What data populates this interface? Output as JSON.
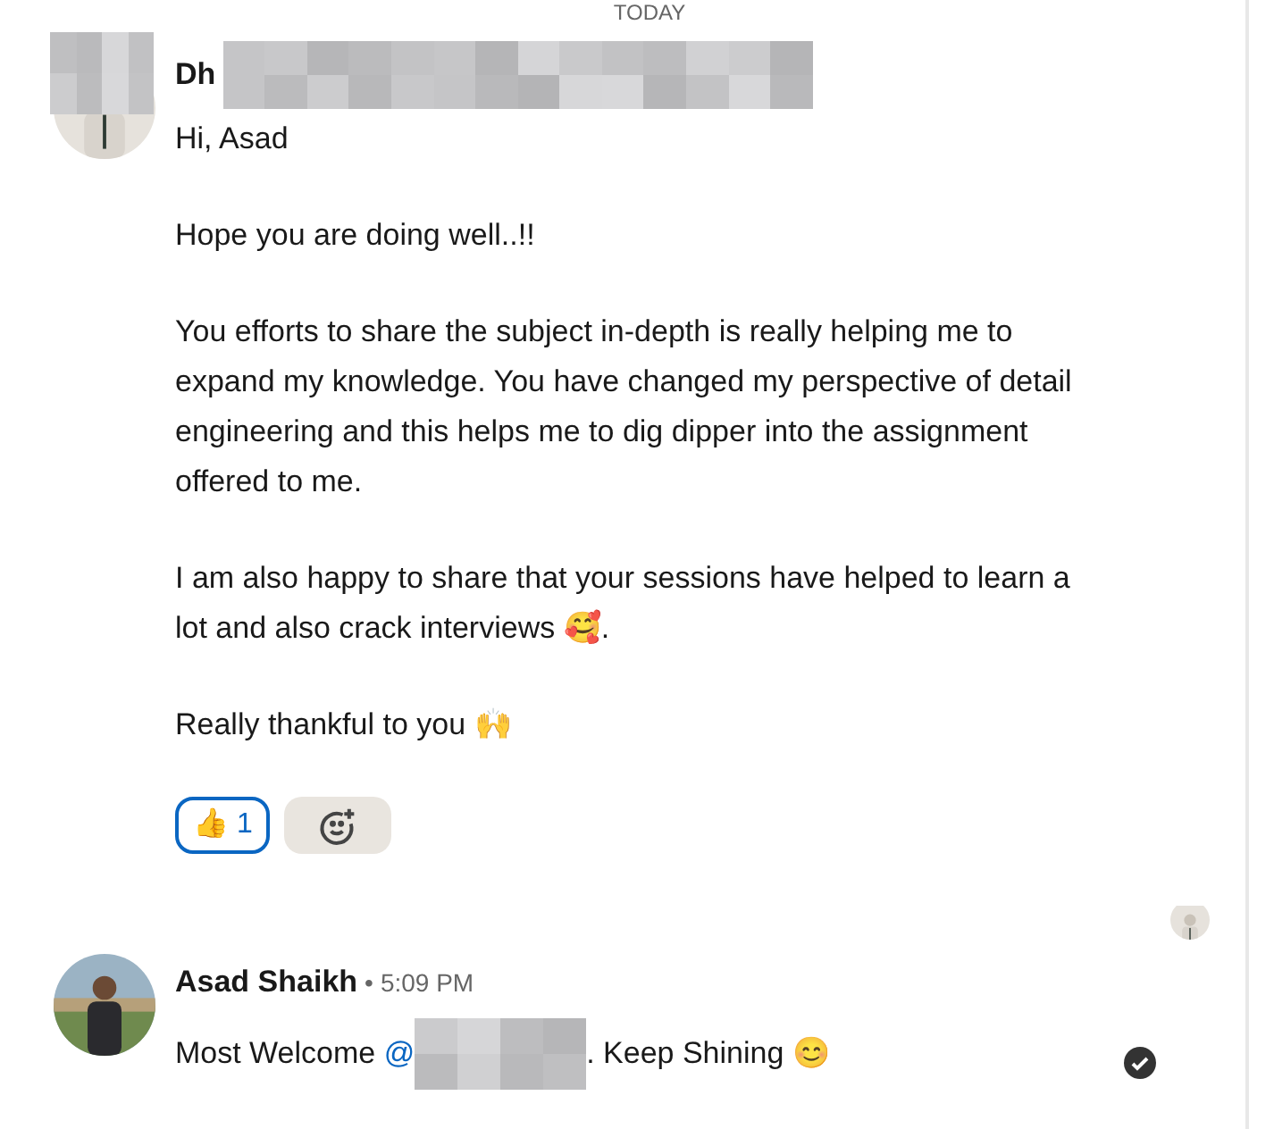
{
  "divider": {
    "label": "TODAY"
  },
  "messages": [
    {
      "sender": "Dh",
      "sender_redacted": true,
      "paragraphs": [
        "Hi, Asad",
        "Hope you are doing well..!!",
        "You efforts to share the subject in-depth is really helping me to expand my knowledge. You have changed my perspective of detail engineering and this helps me to dig dipper into the assignment offered to me.",
        "I am also happy to share that your sessions have helped to learn a lot and also crack interviews 🥰.",
        "Really thankful to you 🙌"
      ],
      "reactions": [
        {
          "emoji": "👍",
          "count": "1",
          "selected": true
        }
      ],
      "add_reaction": true,
      "read_receipt": false
    },
    {
      "sender": "Asad Shaikh",
      "sender_redacted": false,
      "separator": "•",
      "time": "5:09 PM",
      "parts": [
        {
          "text": "Most Welcome "
        },
        {
          "kind": "mention",
          "text": "@"
        },
        {
          "kind": "redacted"
        },
        {
          "text": ". Keep Shining 😊"
        }
      ],
      "read_receipt": true,
      "sent": true
    }
  ]
}
